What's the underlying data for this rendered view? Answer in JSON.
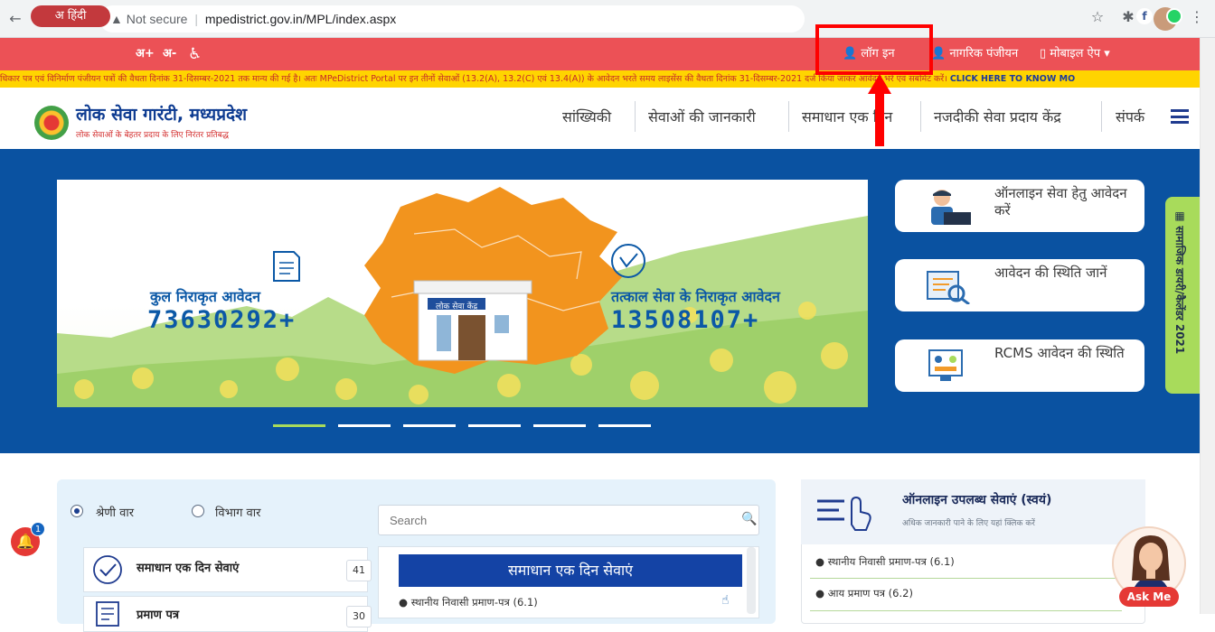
{
  "browser": {
    "security": "Not secure",
    "url": "mpedistrict.gov.in/MPL/index.aspx"
  },
  "topbar": {
    "language_label": "हिंदी",
    "font_increase": "अ+",
    "font_decrease": "अ-",
    "login_label": "लॉग इन",
    "citizen_register_label": "नागरिक पंजीयन",
    "mobile_app_label": "मोबाइल ऐप"
  },
  "ticker": {
    "text": "धिकार पत्र एवं विनिर्माण पंजीयन पत्रों की वैधता दिनांक 31-दिसम्बर-2021 तक मान्य की गई है। अतः MPeDistrict Portal पर इन तीनों सेवाओं (13.2(A), 13.2(C) एवं 13.4(A)) के आवेदन भरते समय लाइसेंस की वैधता दिनांक 31-दिसम्बर-2021 दर्ज किया जाकर आवेदन भरें एवं सबमिट करें।",
    "cta": "CLICK HERE TO KNOW MO"
  },
  "header": {
    "title": "लोक सेवा गारंटी, मध्यप्रदेश",
    "tagline": "लोक सेवाओं के बेहतर प्रदाय के लिए निरंतर प्रतिबद्ध",
    "menu": [
      "सांख्यिकी",
      "सेवाओं की जानकारी",
      "समाधान एक दिन",
      "नजदीकी सेवा प्रदाय केंद्र",
      "संपर्क"
    ]
  },
  "banner": {
    "stat1_label": "कुल निराकृत आवेदन",
    "stat1_value": "73630292+",
    "stat2_label": "तत्काल सेवा के निराकृत आवेदन",
    "stat2_value": "13508107+",
    "building_sign": "लोक सेवा केंद्र",
    "slide_count": 6,
    "active_slide": 1
  },
  "side_cards": [
    {
      "label": "ऑनलाइन सेवा हेतु आवेदन करें"
    },
    {
      "label": "आवेदन की स्थिति जानें"
    },
    {
      "label": "RCMS आवेदन की स्थिति"
    }
  ],
  "calendar_tab": "सामाजिक डायरी/कैलेंडर 2021",
  "services": {
    "radio_category": "श्रेणी वार",
    "radio_department": "विभाग वार",
    "search_placeholder": "Search",
    "categories": [
      {
        "label": "समाधान एक दिन सेवाएं",
        "count": "41"
      },
      {
        "label": "प्रमाण पत्र",
        "count": "30"
      }
    ],
    "list_title": "समाधान एक दिन सेवाएं",
    "list_items": [
      "स्थानीय निवासी प्रमाण-पत्र (6.1)"
    ]
  },
  "right_panel": {
    "title": "ऑनलाइन उपलब्ध सेवाएं (स्वयं)",
    "subtitle": "अधिक जानकारी पाने के लिए यहां क्लिक करें",
    "items": [
      "स्थानीय निवासी प्रमाण-पत्र (6.1)",
      "आय प्रमाण पत्र (6.2)"
    ]
  },
  "notifications": {
    "count": "1"
  },
  "ask_me": "Ask Me",
  "colors": {
    "topbar": "#ec5156",
    "ticker": "#ffd400",
    "banner": "#0a52a1",
    "heading_blue": "#0d3b91",
    "highlight": "#ff0000"
  }
}
